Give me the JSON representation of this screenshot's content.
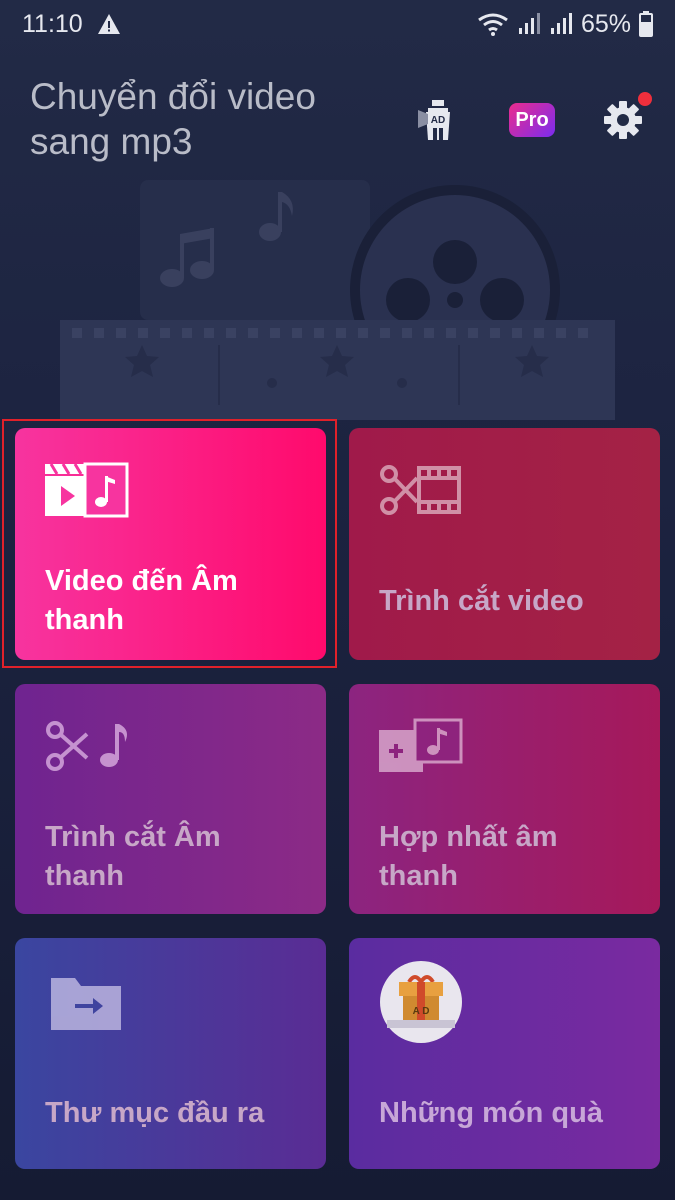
{
  "status_bar": {
    "time": "11:10",
    "battery": "65%"
  },
  "header": {
    "title": "Chuyển đổi video sang mp3",
    "ad_badge_text": "AD",
    "pro_label": "Pro",
    "notification_dot_color": "#ef2f3c"
  },
  "cards": [
    {
      "label": "Video đến Âm thanh",
      "icon": "video-to-audio-icon",
      "color_start": "#f7349f",
      "color_end": "#ff0a6c",
      "selected": true
    },
    {
      "label": "Trình cắt video",
      "icon": "video-cutter-icon",
      "color_start": "#a01a4a",
      "color_end": "#a42245"
    },
    {
      "label": "Trình cắt Âm thanh",
      "icon": "audio-cutter-icon",
      "color_start": "#6f2490",
      "color_end": "#8c2a86"
    },
    {
      "label": "Hợp nhất âm thanh",
      "icon": "audio-merge-icon",
      "color_start": "#8c2480",
      "color_end": "#a6195a"
    },
    {
      "label": "Thư mục đầu ra",
      "icon": "output-folder-icon",
      "color_start": "#3a46a0",
      "color_end": "#5a2c94"
    },
    {
      "label": "Những món quà",
      "icon": "gift-icon",
      "color_start": "#5a2ca0",
      "color_end": "#7a2aa0"
    }
  ],
  "gift_badge_text": "A D",
  "highlight_color": "#e0212a"
}
